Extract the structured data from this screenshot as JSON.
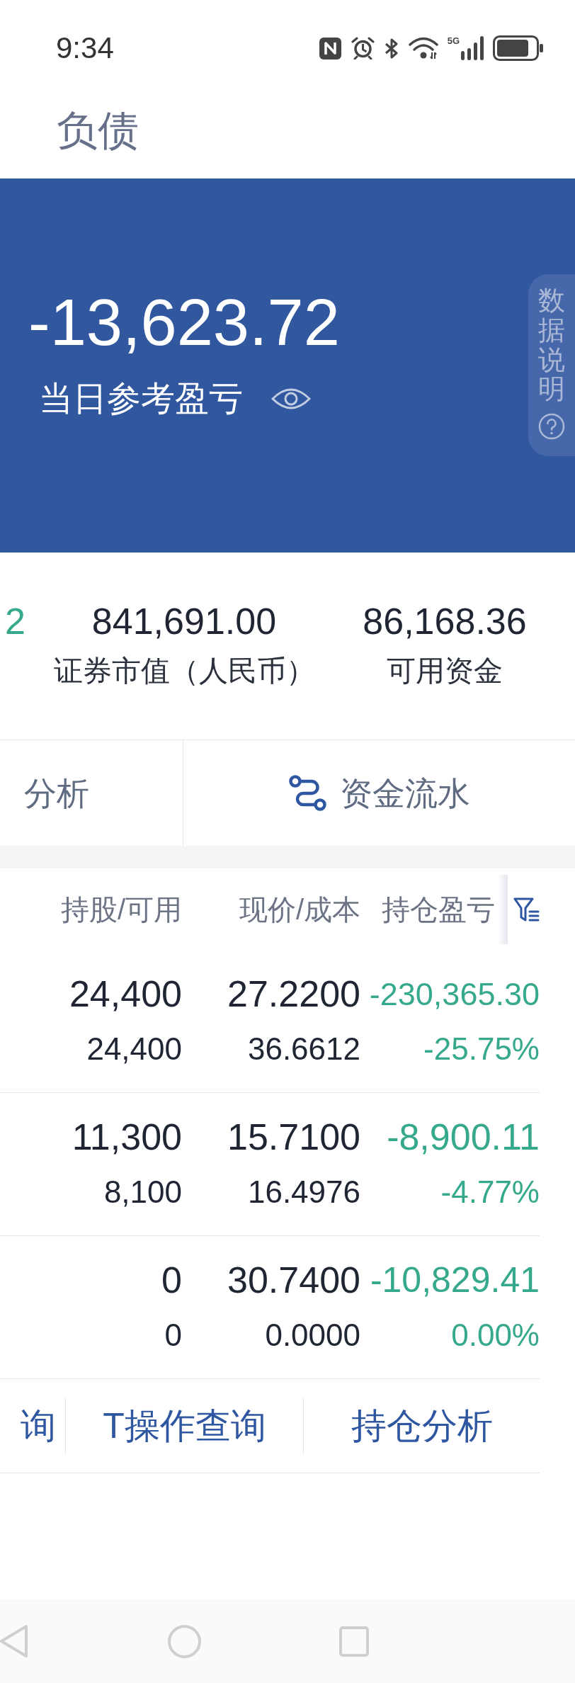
{
  "status_bar": {
    "time": "9:34",
    "network": "5G"
  },
  "tabs": [
    {
      "label": "负债",
      "selected": false
    }
  ],
  "summary": {
    "value": "-13,623.72",
    "label": "当日参考盈亏",
    "note": "数据说明"
  },
  "stats": [
    {
      "value": "2",
      "color": "#36a98c"
    },
    {
      "value": "841,691.00",
      "label": "证券市值（人民币）",
      "color": "#1f2533"
    },
    {
      "value": "86,168.36",
      "label": "可用资金",
      "color": "#1f2533"
    }
  ],
  "actions": [
    {
      "kind": "plain",
      "label": "分析"
    },
    {
      "kind": "flow",
      "label": "资金流水"
    }
  ],
  "table": {
    "columns": [
      "持股/可用",
      "现价/成本",
      "持仓盈亏"
    ],
    "rows": [
      {
        "shares": "24,400",
        "available": "24,400",
        "price": "27.2200",
        "cost": "36.6612",
        "pnl": "-230,365.30",
        "pnl_percent": "-25.75%"
      },
      {
        "shares": "11,300",
        "available": "8,100",
        "price": "15.7100",
        "cost": "16.4976",
        "pnl": "-8,900.11",
        "pnl_percent": "-4.77%"
      },
      {
        "shares": "0",
        "available": "0",
        "price": "30.7400",
        "cost": "0.0000",
        "pnl": "-10,829.41",
        "pnl_percent": "0.00%"
      }
    ]
  },
  "bottom_links": [
    "询",
    "T操作查询",
    "持仓分析"
  ]
}
